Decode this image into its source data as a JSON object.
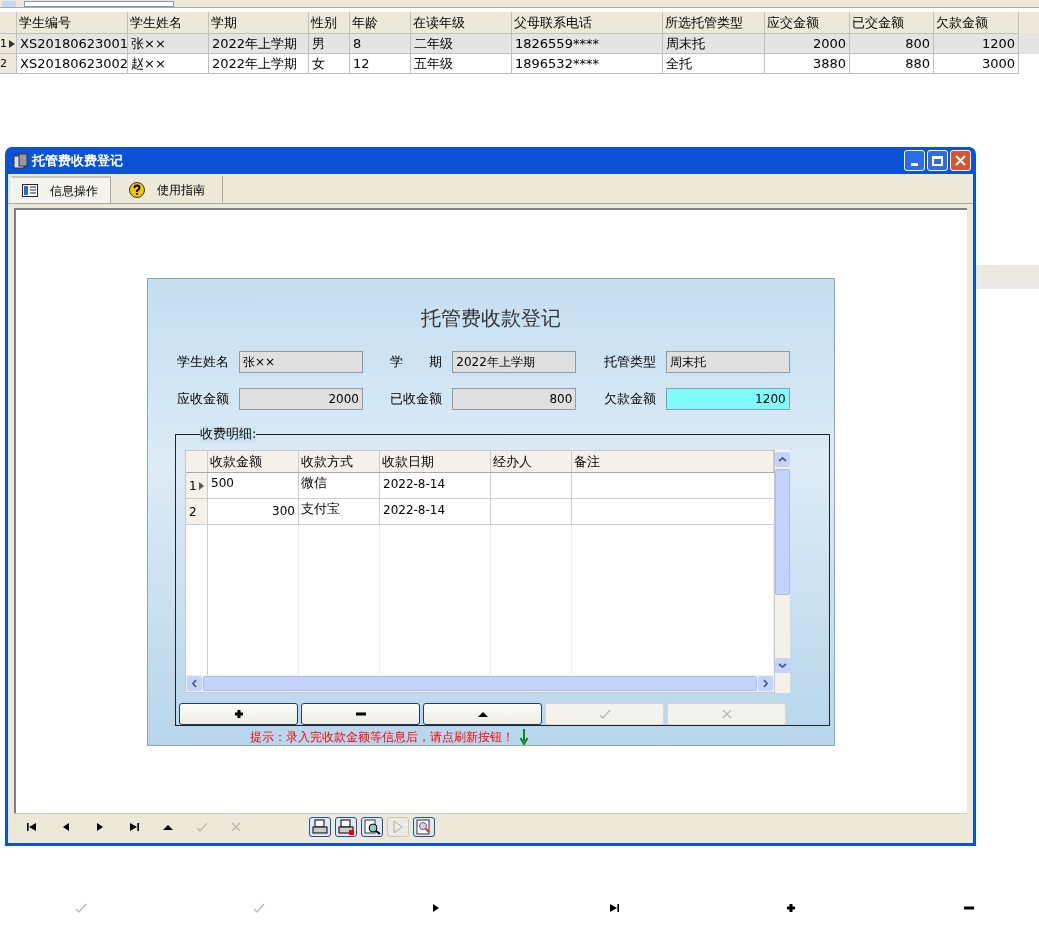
{
  "student_table": {
    "columns": [
      "学生编号",
      "学生姓名",
      "学期",
      "性别",
      "年龄",
      "在读年级",
      "父母联系电话",
      "所选托管类型",
      "应交金额",
      "已交金额",
      "欠款金额"
    ],
    "rows": [
      {
        "number": "1",
        "selected": true,
        "cells": [
          "XS20180623001",
          "张××",
          "2022年上学期",
          "男",
          "8",
          "二年级",
          "1826559****",
          "周末托",
          "2000",
          "800",
          "1200"
        ]
      },
      {
        "number": "2",
        "selected": false,
        "cells": [
          "XS20180623002",
          "赵××",
          "2022年上学期",
          "女",
          "12",
          "五年级",
          "1896532****",
          "全托",
          "3880",
          "880",
          "3000"
        ]
      }
    ]
  },
  "window": {
    "title": "托管费收费登记",
    "tabs": [
      {
        "label": "信息操作",
        "kind": "list",
        "selected": true
      },
      {
        "label": "使用指南",
        "kind": "help",
        "selected": false
      }
    ]
  },
  "form": {
    "title": "托管费收款登记",
    "fields": [
      {
        "label": "学生姓名",
        "value": "张××",
        "kind": "text",
        "highlighted": false
      },
      {
        "label": "学　　期",
        "value": "2022年上学期",
        "kind": "text",
        "highlighted": false
      },
      {
        "label": "托管类型",
        "value": "周末托",
        "kind": "text",
        "highlighted": false
      },
      {
        "label": "应收金额",
        "value": "2000",
        "kind": "amount",
        "highlighted": false
      },
      {
        "label": "已收金额",
        "value": "800",
        "kind": "amount",
        "highlighted": false
      },
      {
        "label": "欠款金额",
        "value": "1200",
        "kind": "amount",
        "highlighted": true
      }
    ],
    "details": {
      "legend": "收费明细:",
      "columns": [
        "收款金额",
        "收款方式",
        "收款日期",
        "经办人",
        "备注"
      ],
      "rows": [
        {
          "number": "1",
          "current": true,
          "amount": "500",
          "method": "微信",
          "date": "2022-8-14"
        },
        {
          "number": "2",
          "current": false,
          "amount": "300",
          "method": "支付宝",
          "date": "2022-8-14"
        }
      ]
    },
    "buttons": [
      {
        "kind": "add",
        "disabled": false
      },
      {
        "kind": "remove",
        "disabled": false
      },
      {
        "kind": "up",
        "disabled": false
      },
      {
        "kind": "confirm",
        "disabled": true
      },
      {
        "kind": "cancel",
        "disabled": true
      }
    ],
    "hint": "提示：录入完收款金额等信息后，请点刷新按钮！"
  },
  "nav_buttons": [
    {
      "kind": "first",
      "disabled": false
    },
    {
      "kind": "prev",
      "disabled": false
    },
    {
      "kind": "next",
      "disabled": false
    },
    {
      "kind": "last",
      "disabled": false
    },
    {
      "kind": "up",
      "disabled": false
    },
    {
      "kind": "confirm",
      "disabled": true
    },
    {
      "kind": "cancel",
      "disabled": true
    },
    {
      "kind": "gap"
    },
    {
      "kind": "print",
      "disabled": false
    },
    {
      "kind": "print-export",
      "disabled": false
    },
    {
      "kind": "preview",
      "disabled": false
    },
    {
      "kind": "play",
      "disabled": true
    },
    {
      "kind": "zoom",
      "disabled": false
    }
  ]
}
